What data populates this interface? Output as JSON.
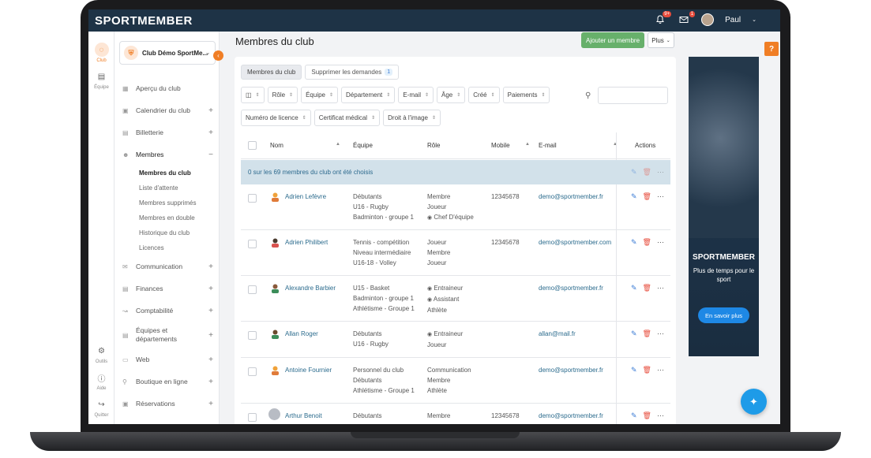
{
  "app": {
    "logo": "SPORTMEMBER",
    "user_name": "Paul",
    "notif_badge": "9+",
    "mail_badge": "1"
  },
  "rail": [
    {
      "label": "Club",
      "icon": "chat-icon"
    },
    {
      "label": "Équipe",
      "icon": "team-icon"
    },
    {
      "label": "Outils",
      "icon": "gear-icon"
    },
    {
      "label": "Aide",
      "icon": "help-icon"
    },
    {
      "label": "Quitter",
      "icon": "logout-icon"
    }
  ],
  "club_selector": {
    "label": "Club Démo SportMe..."
  },
  "sidebar": {
    "items": [
      {
        "label": "Aperçu du club",
        "plus": ""
      },
      {
        "label": "Calendrier du club",
        "plus": "+"
      },
      {
        "label": "Billetterie",
        "plus": "+"
      },
      {
        "label": "Membres",
        "plus": "−"
      },
      {
        "label": "Communication",
        "plus": "+"
      },
      {
        "label": "Finances",
        "plus": "+"
      },
      {
        "label": "Comptabilité",
        "plus": "+"
      },
      {
        "label": "Équipes et départements",
        "plus": "+"
      },
      {
        "label": "Web",
        "plus": "+"
      },
      {
        "label": "Boutique en ligne",
        "plus": "+"
      },
      {
        "label": "Réservations",
        "plus": "+"
      }
    ],
    "members_sub": [
      "Membres du club",
      "Liste d'attente",
      "Membres supprimés",
      "Membres en double",
      "Historique du club",
      "Licences"
    ]
  },
  "page": {
    "title": "Membres du club",
    "add_label": "Ajouter un membre",
    "plus_label": "Plus"
  },
  "tabs": [
    {
      "label": "Membres du club"
    },
    {
      "label": "Supprimer les demandes",
      "count": "1"
    }
  ],
  "filters": [
    "Rôle",
    "Équipe",
    "Département",
    "E-mail",
    "Âge",
    "Créé",
    "Paiements",
    "Numéro de licence",
    "Certificat médical",
    "Droit à l'image"
  ],
  "columns": {
    "name": "Nom",
    "team": "Équipe",
    "role": "Rôle",
    "mobile": "Mobile",
    "email": "E-mail",
    "actions": "Actions"
  },
  "selection_text": "0 sur les 69 membres du club ont été choisis",
  "rows": [
    {
      "name": "Adrien Lefèvre",
      "team": [
        "Débutants",
        "U16 - Rugby",
        "Badminton - groupe 1"
      ],
      "role": [
        "Membre",
        "Joueur",
        "Chef D'équipe"
      ],
      "mobile": "12345678",
      "email": "demo@sportmember.fr"
    },
    {
      "name": "Adrien Philibert",
      "team": [
        "Tennis - compétition",
        "Niveau intermédiaire",
        "U16-18 - Volley"
      ],
      "role": [
        "Joueur",
        "Membre",
        "Joueur"
      ],
      "mobile": "12345678",
      "email": "demo@sportmember.com"
    },
    {
      "name": "Alexandre Barbier",
      "team": [
        "U15 - Basket",
        "Badminton - groupe 1",
        "Athlétisme - Groupe 1"
      ],
      "role": [
        "Entraineur",
        "Assistant",
        "Athlète"
      ],
      "mobile": "",
      "email": "demo@sportmember.fr"
    },
    {
      "name": "Allan Roger",
      "team": [
        "Débutants",
        "U16 - Rugby",
        ""
      ],
      "role": [
        "Entraineur",
        "Joueur",
        ""
      ],
      "mobile": "",
      "email": "allan@mail.fr"
    },
    {
      "name": "Antoine Fournier",
      "team": [
        "Personnel du club",
        "Débutants",
        "Athlétisme - Groupe 1"
      ],
      "role": [
        "Communication",
        "Membre",
        "Athlète"
      ],
      "mobile": "",
      "email": "demo@sportmember.fr"
    },
    {
      "name": "Arthur Benoit",
      "team": [
        "Débutants",
        "",
        ""
      ],
      "role": [
        "Membre",
        "",
        ""
      ],
      "mobile": "12345678",
      "email": "demo@sportmember.fr"
    }
  ],
  "ad": {
    "logo": "SPORTMEMBER",
    "tagline": "Plus de temps pour le sport",
    "cta": "En savoir plus"
  },
  "help_label": "?",
  "colors": {
    "topbar": "#1e3346",
    "accent": "#f07e25",
    "link": "#2b6b8d",
    "add_button": "#67b06b",
    "fab": "#1e9be8"
  }
}
